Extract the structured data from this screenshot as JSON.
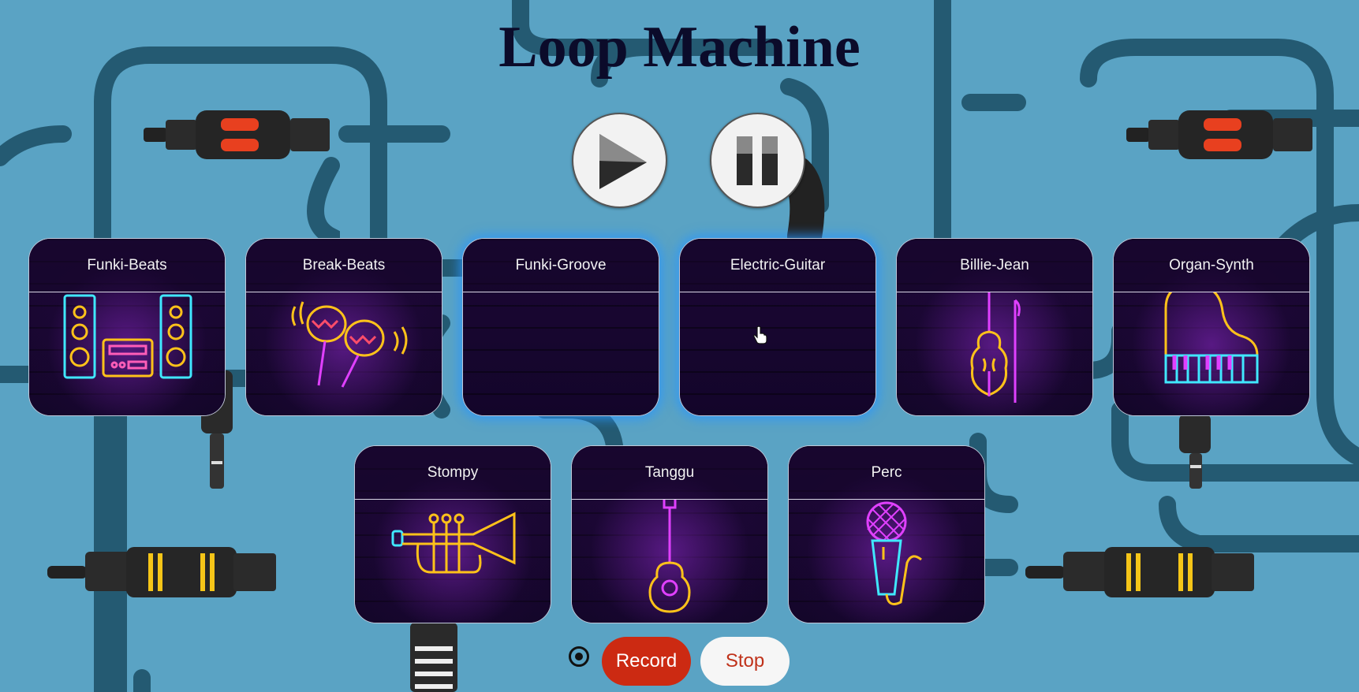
{
  "app": {
    "title": "Loop Machine"
  },
  "controls": {
    "play": {
      "icon": "play-icon"
    },
    "pause": {
      "icon": "pause-icon"
    }
  },
  "pads": [
    {
      "label": "Funki-Beats",
      "icon": "speakers-stereo-icon",
      "active": true
    },
    {
      "label": "Break-Beats",
      "icon": "maracas-icon",
      "active": true
    },
    {
      "label": "Funki-Groove",
      "icon": "",
      "active": false
    },
    {
      "label": "Electric-Guitar",
      "icon": "",
      "active": false
    },
    {
      "label": "Billie-Jean",
      "icon": "violin-icon",
      "active": true
    },
    {
      "label": "Organ-Synth",
      "icon": "piano-icon",
      "active": true
    },
    {
      "label": "Stompy",
      "icon": "trumpet-icon",
      "active": true
    },
    {
      "label": "Tanggu",
      "icon": "guitar-icon",
      "active": true
    },
    {
      "label": "Perc",
      "icon": "microphone-icon",
      "active": true
    }
  ],
  "recording": {
    "record_label": "Record",
    "stop_label": "Stop",
    "indicator_icon": "record-radio-icon"
  },
  "colors": {
    "background": "#5aa3c4",
    "cable": "#245a72",
    "record": "#cc2a12",
    "pad_bg": "#140628",
    "neon_pink": "#e040ff",
    "neon_yellow": "#ffc21a",
    "neon_cyan": "#40e8ff",
    "active_glow": "#2896ff"
  }
}
